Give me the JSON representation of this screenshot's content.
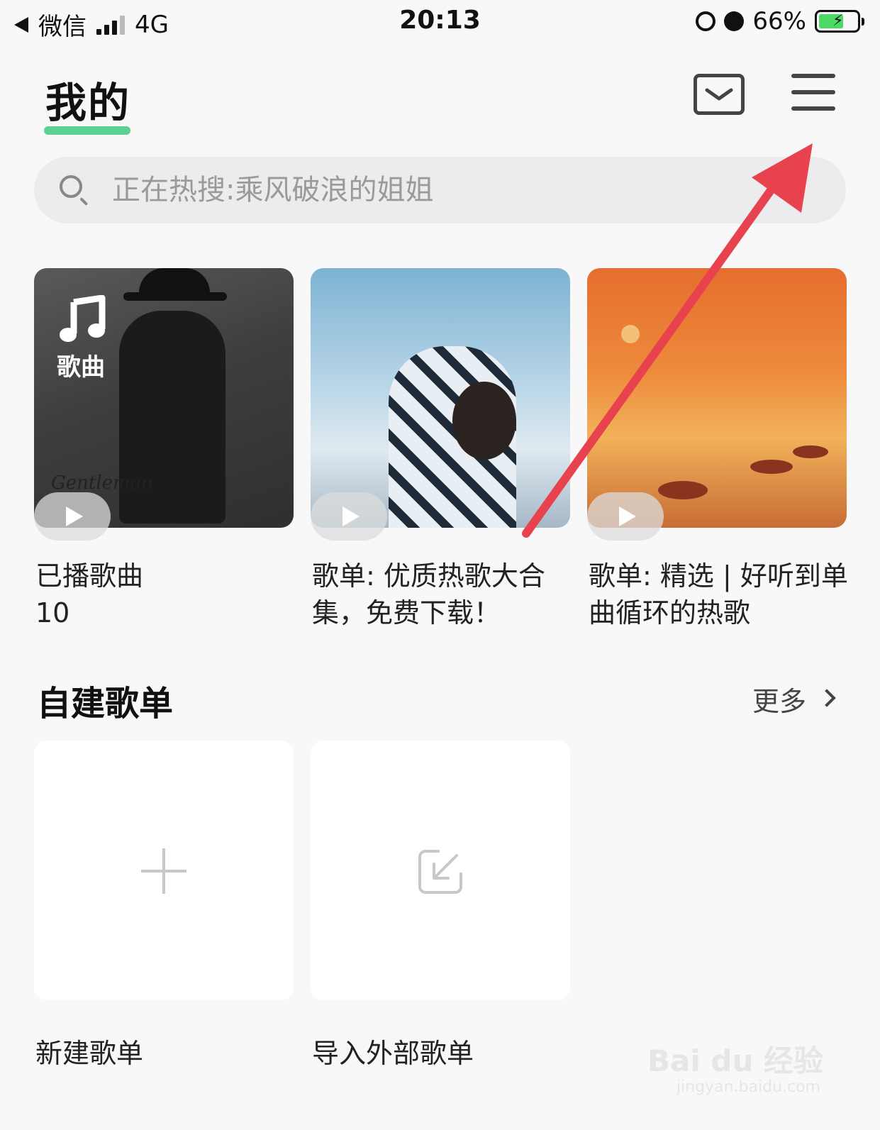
{
  "status_bar": {
    "back_app": "微信",
    "network": "4G",
    "time": "20:13",
    "battery": "66%",
    "battery_level": 0.66
  },
  "header": {
    "title": "我的"
  },
  "search": {
    "placeholder": "正在热搜:乘风破浪的姐姐"
  },
  "covers": [
    {
      "title": "已播歌曲",
      "subtitle": "10",
      "badge": "歌曲",
      "cover_text": "Gentleman"
    },
    {
      "title": "歌单: 优质热歌大合集，免费下载！"
    },
    {
      "title": "歌单: 精选 | 好听到单曲循环的热歌"
    }
  ],
  "section": {
    "title": "自建歌单",
    "more": "更多"
  },
  "tiles": [
    {
      "label": "新建歌单"
    },
    {
      "label": "导入外部歌单"
    }
  ],
  "watermark": {
    "brand": "Bai du 经验",
    "url": "jingyan.baidu.com"
  },
  "colors": {
    "accent": "#5ccf93",
    "annotation_arrow": "#e8424e"
  }
}
